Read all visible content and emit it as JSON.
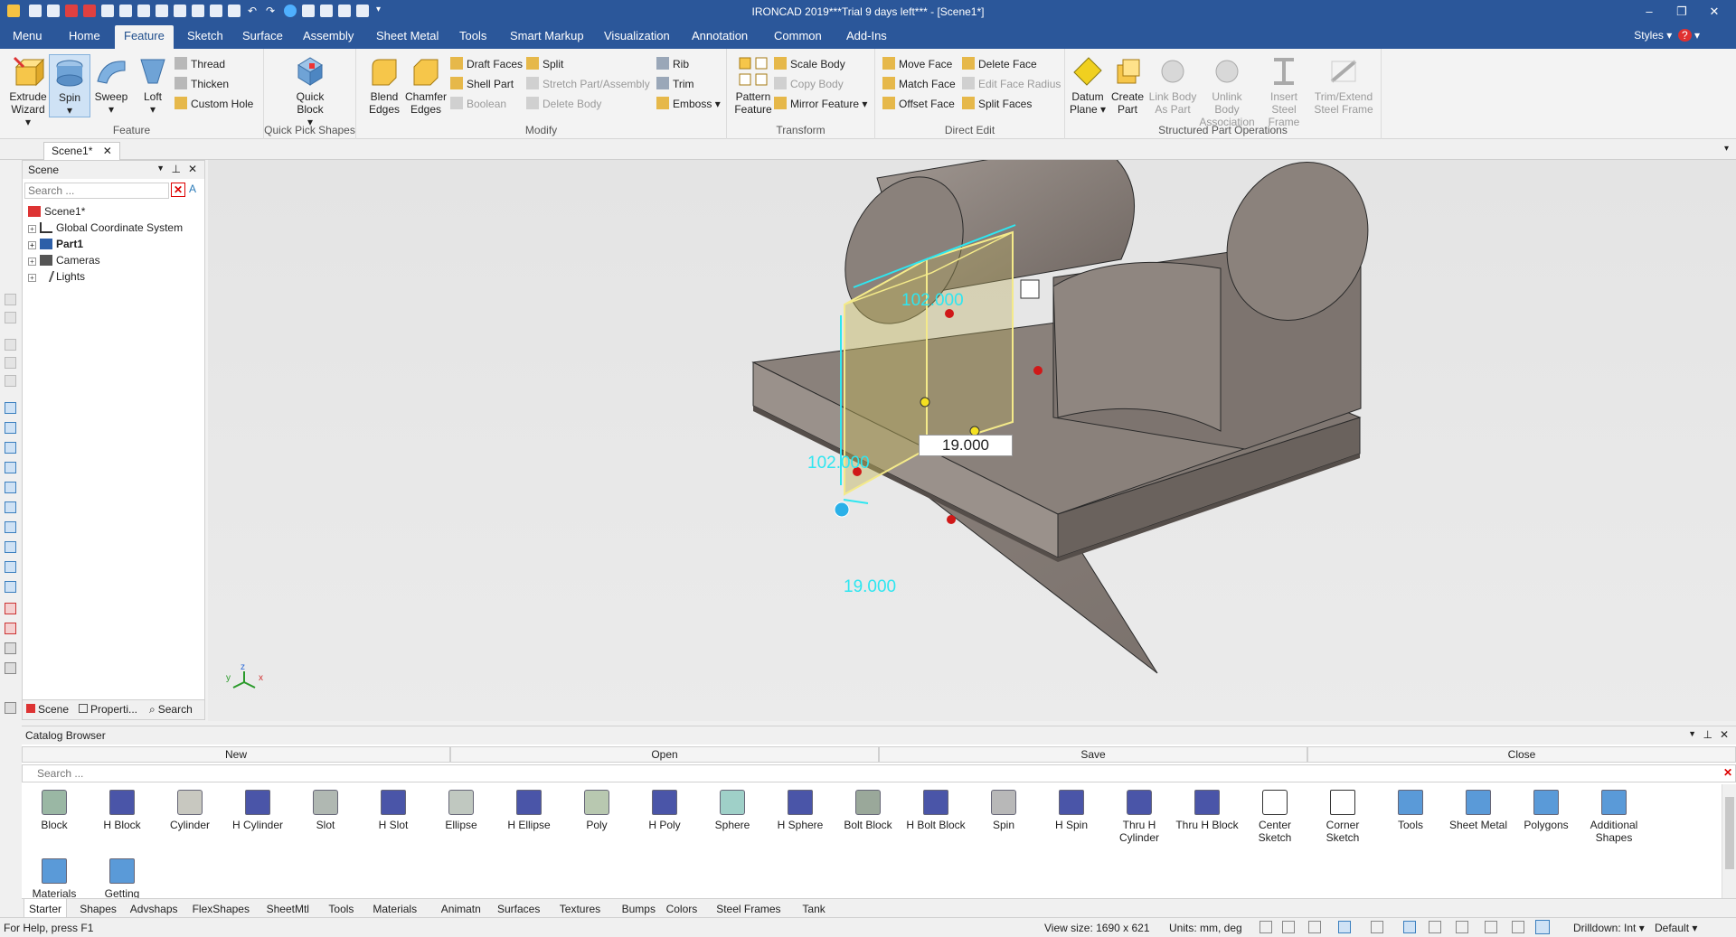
{
  "window": {
    "title": "IRONCAD 2019***Trial 9 days left*** - [Scene1*]",
    "minimize": "–",
    "restore": "❐",
    "close": "✕"
  },
  "menu": {
    "tabs": [
      "Menu",
      "Home",
      "Feature",
      "Sketch",
      "Surface",
      "Assembly",
      "Sheet Metal",
      "Tools",
      "Smart Markup",
      "Visualization",
      "Annotation",
      "Common",
      "Add-Ins"
    ],
    "active": "Feature",
    "styles_label": "Styles",
    "help": "?"
  },
  "ribbon": {
    "feature": {
      "label": "Feature",
      "extrude": "Extrude Wizard",
      "spin": "Spin",
      "sweep": "Sweep",
      "loft": "Loft",
      "thread": "Thread",
      "thicken": "Thicken",
      "custom_hole": "Custom Hole"
    },
    "quickpick": {
      "label": "Quick Pick Shapes",
      "quick_block": "Quick Block"
    },
    "modify": {
      "label": "Modify",
      "blend": "Blend Edges",
      "chamfer": "Chamfer Edges",
      "draft": "Draft Faces",
      "shell": "Shell Part",
      "boolean": "Boolean",
      "split": "Split",
      "stretch": "Stretch Part/Assembly",
      "delete_body": "Delete Body",
      "rib": "Rib",
      "trim": "Trim",
      "emboss": "Emboss"
    },
    "transform": {
      "label": "Transform",
      "pattern": "Pattern Feature",
      "scale": "Scale Body",
      "copy": "Copy Body",
      "mirror": "Mirror Feature"
    },
    "direct": {
      "label": "Direct Edit",
      "move_face": "Move Face",
      "match_face": "Match Face",
      "offset_face": "Offset Face",
      "delete_face": "Delete Face",
      "edit_face_radius": "Edit Face Radius",
      "split_faces": "Split Faces"
    },
    "structured": {
      "label": "Structured Part Operations",
      "datum": "Datum Plane",
      "create_part": "Create Part",
      "link_body": "Link Body As Part",
      "unlink_body": "Unlink Body Association",
      "insert_steel": "Insert Steel Frame",
      "trim_extend": "Trim/Extend Steel Frame"
    }
  },
  "doc_tab": "Scene1*",
  "scene_panel": {
    "title": "Scene",
    "search_placeholder": "Search ...",
    "tree": [
      "Scene1*",
      "Global Coordinate System",
      "Part1",
      "Cameras",
      "Lights"
    ],
    "tabs": [
      "Scene",
      "Properti...",
      "Search"
    ]
  },
  "viewport": {
    "dim_top": "102.000",
    "dim_left": "102.000",
    "dim_bottom": "19.000",
    "dim_input": "19.000",
    "axis_x": "x",
    "axis_y": "y",
    "axis_z": "z"
  },
  "catalog": {
    "title": "Catalog Browser",
    "buttons": [
      "New",
      "Open",
      "Save",
      "Close"
    ],
    "search_placeholder": "Search ...",
    "items": [
      "Block",
      "H Block",
      "Cylinder",
      "H Cylinder",
      "Slot",
      "H Slot",
      "Ellipse",
      "H Ellipse",
      "Poly",
      "H Poly",
      "Sphere",
      "H Sphere",
      "Bolt Block",
      "H Bolt Block",
      "Spin",
      "H Spin",
      "Thru H Cylinder",
      "Thru H Block",
      "Center Sketch",
      "Corner Sketch",
      "Tools",
      "Sheet Metal",
      "Polygons",
      "Additional Shapes",
      "Materials",
      "Getting"
    ],
    "tabs": [
      "Starter",
      "Shapes",
      "Advshaps",
      "FlexShapes",
      "SheetMtl",
      "Tools",
      "Materials",
      "Animatn",
      "Surfaces",
      "Textures",
      "Bumps",
      "Colors",
      "Steel Frames",
      "Tank"
    ],
    "active_tab": "Starter"
  },
  "status": {
    "help": "For Help, press F1",
    "view_size": "View size: 1690 x 621",
    "units": "Units: mm, deg",
    "drilldown": "Drilldown: Int",
    "default": "Default"
  }
}
